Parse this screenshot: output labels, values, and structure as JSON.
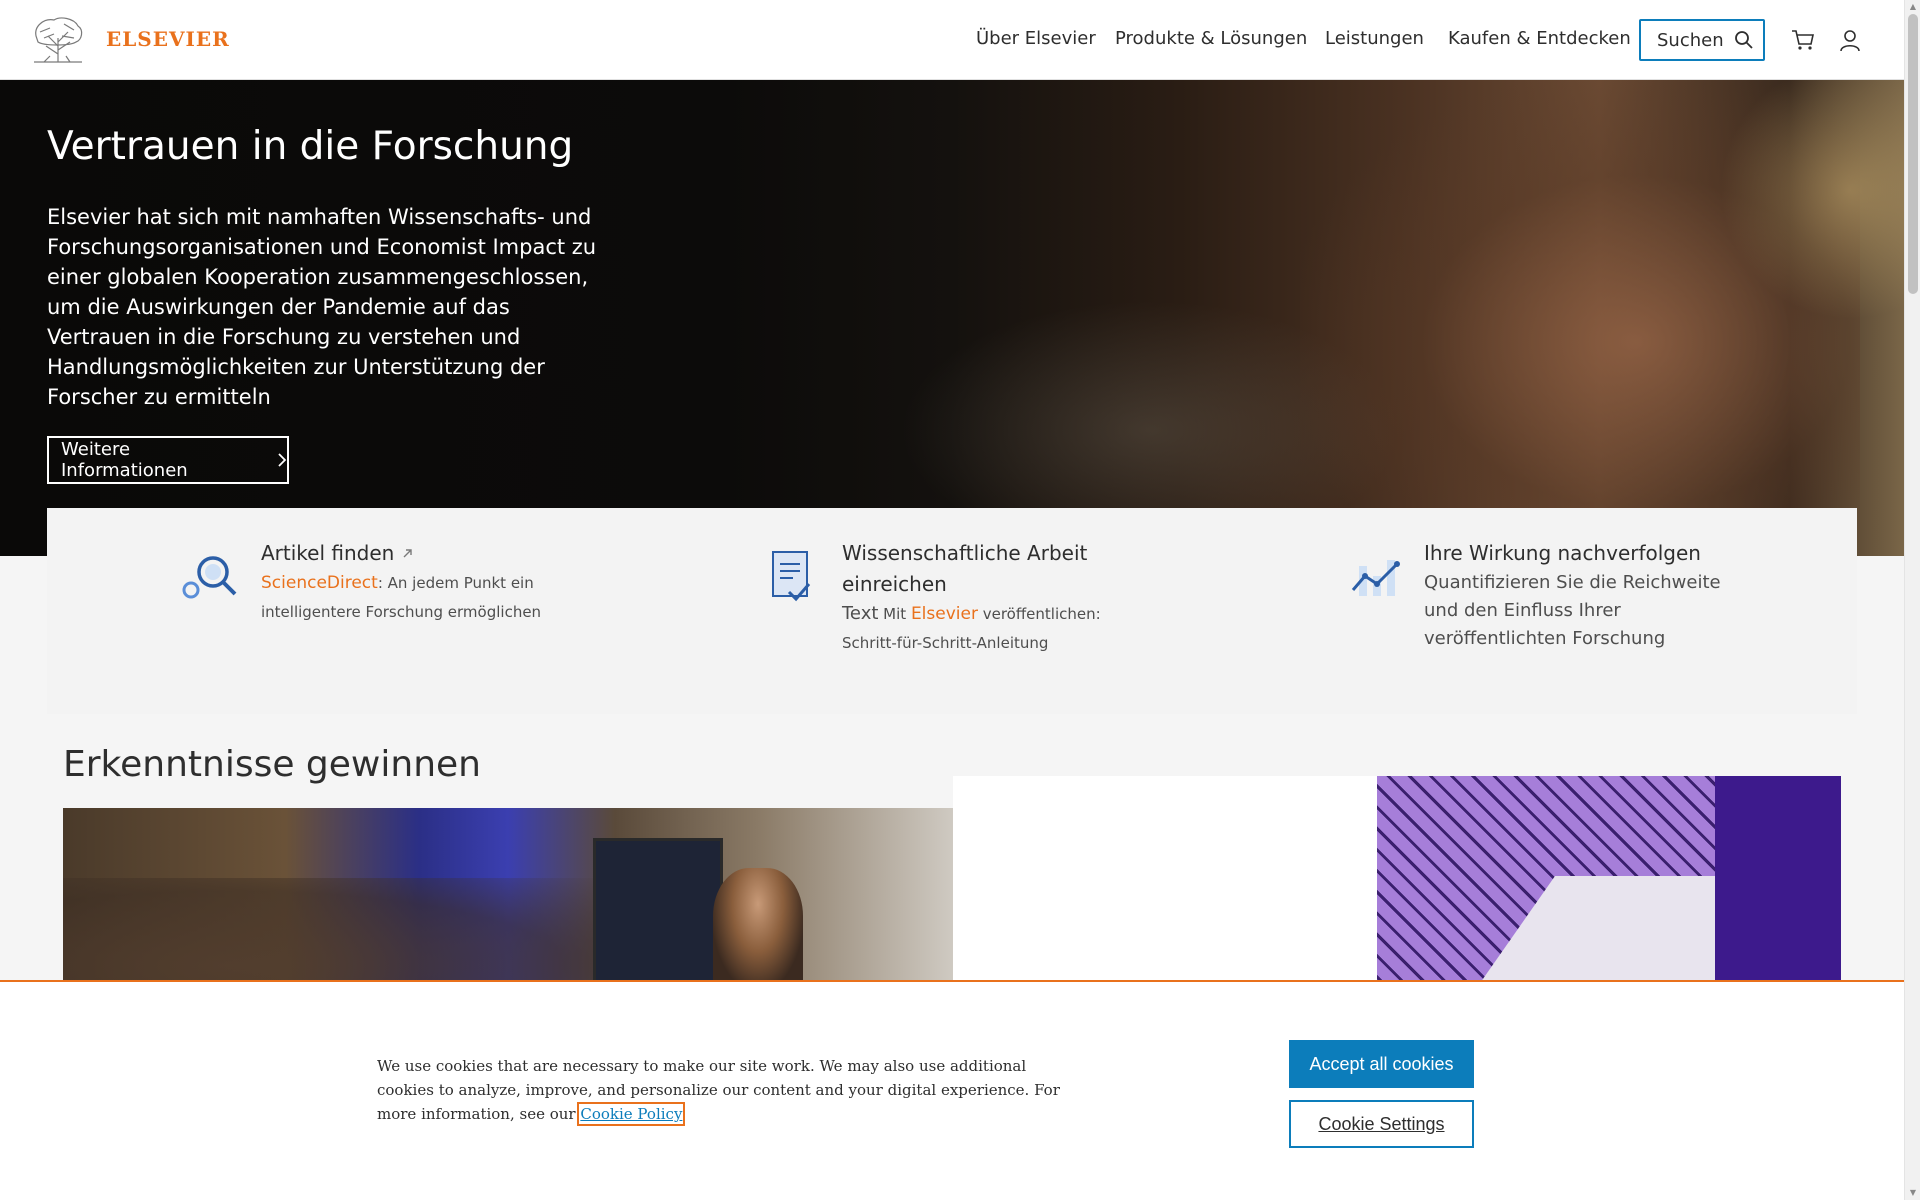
{
  "header": {
    "logo_text": "ELSEVIER",
    "nav": [
      "Über Elsevier",
      "Produkte & Lösungen",
      "Leistungen",
      "Kaufen & Entdecken"
    ],
    "search_label": "Suchen",
    "icons": [
      "cart-icon",
      "user-icon",
      "search-icon"
    ]
  },
  "hero": {
    "title": "Vertrauen in die Forschung",
    "text": "Elsevier hat sich mit namhaften Wissenschafts- und Forschungsorganisationen und Economist Impact zu einer globalen Kooperation zusammengeschlossen, um die Auswirkungen der Pandemie auf das Vertrauen in die Forschung zu verstehen und Handlungsmöglichkeiten zur Unterstützung der Forscher zu ermitteln",
    "button": "Weitere Informationen"
  },
  "features": [
    {
      "title": "Artikel finden",
      "link": "ScienceDirect",
      "desc": ": An jedem Punkt ein intelligentere Forschung ermöglichen",
      "icon": "search-magnifier-icon"
    },
    {
      "title": "Wissenschaftliche Arbeit einreichen",
      "prefix": "Text",
      "mid": " Mit ",
      "link": "Elsevier",
      "desc": " veröffentlichen: Schritt-für-Schritt-Anleitung",
      "icon": "document-check-icon"
    },
    {
      "title": "Ihre Wirkung nachverfolgen",
      "desc": "Quantifizieren Sie die Reichweite und den Einfluss Ihrer veröffentlichten Forschung",
      "icon": "chart-trend-icon"
    }
  ],
  "insights": {
    "title": "Erkenntnisse gewinnen"
  },
  "cookie": {
    "text": "We use cookies that are necessary to make our site work. We may also use additional cookies to analyze, improve, and personalize our content and your digital experience. For more information, see our ",
    "link": "Cookie Policy",
    "accept": "Accept all cookies",
    "settings": "Cookie Settings"
  },
  "colors": {
    "brand": "#e9711c",
    "accent": "#0c7dbb"
  }
}
